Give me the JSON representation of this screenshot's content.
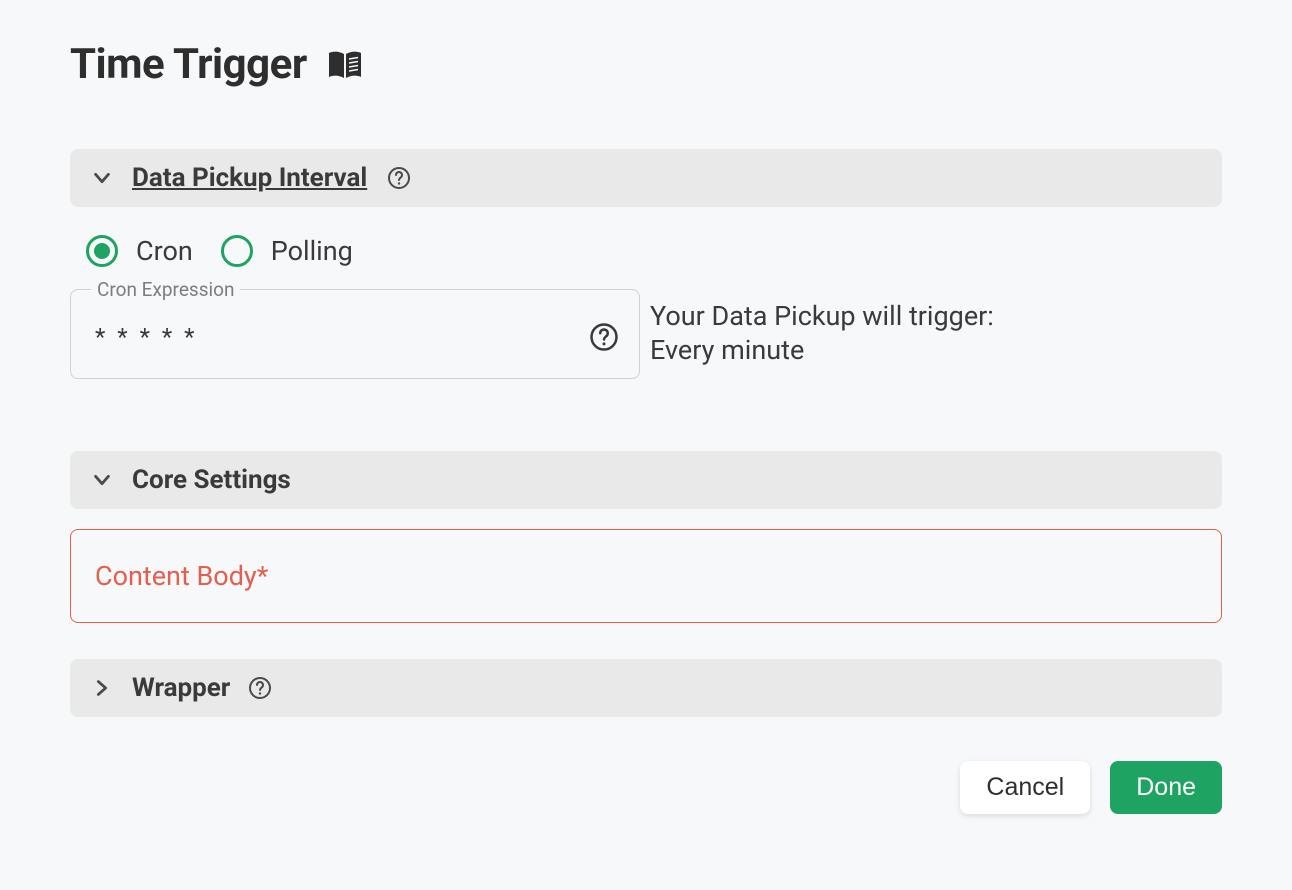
{
  "title": "Time Trigger",
  "sections": {
    "data_pickup": {
      "label": "Data Pickup Interval"
    },
    "core_settings": {
      "label": "Core Settings"
    },
    "wrapper": {
      "label": "Wrapper"
    }
  },
  "radios": {
    "cron": "Cron",
    "polling": "Polling"
  },
  "cron": {
    "legend": "Cron Expression",
    "value": "* * * * *"
  },
  "trigger_info": {
    "line1": "Your Data Pickup will trigger:",
    "line2": "Every minute"
  },
  "content_body": {
    "label": "Content Body",
    "required_mark": "*"
  },
  "footer": {
    "cancel": "Cancel",
    "done": "Done"
  }
}
